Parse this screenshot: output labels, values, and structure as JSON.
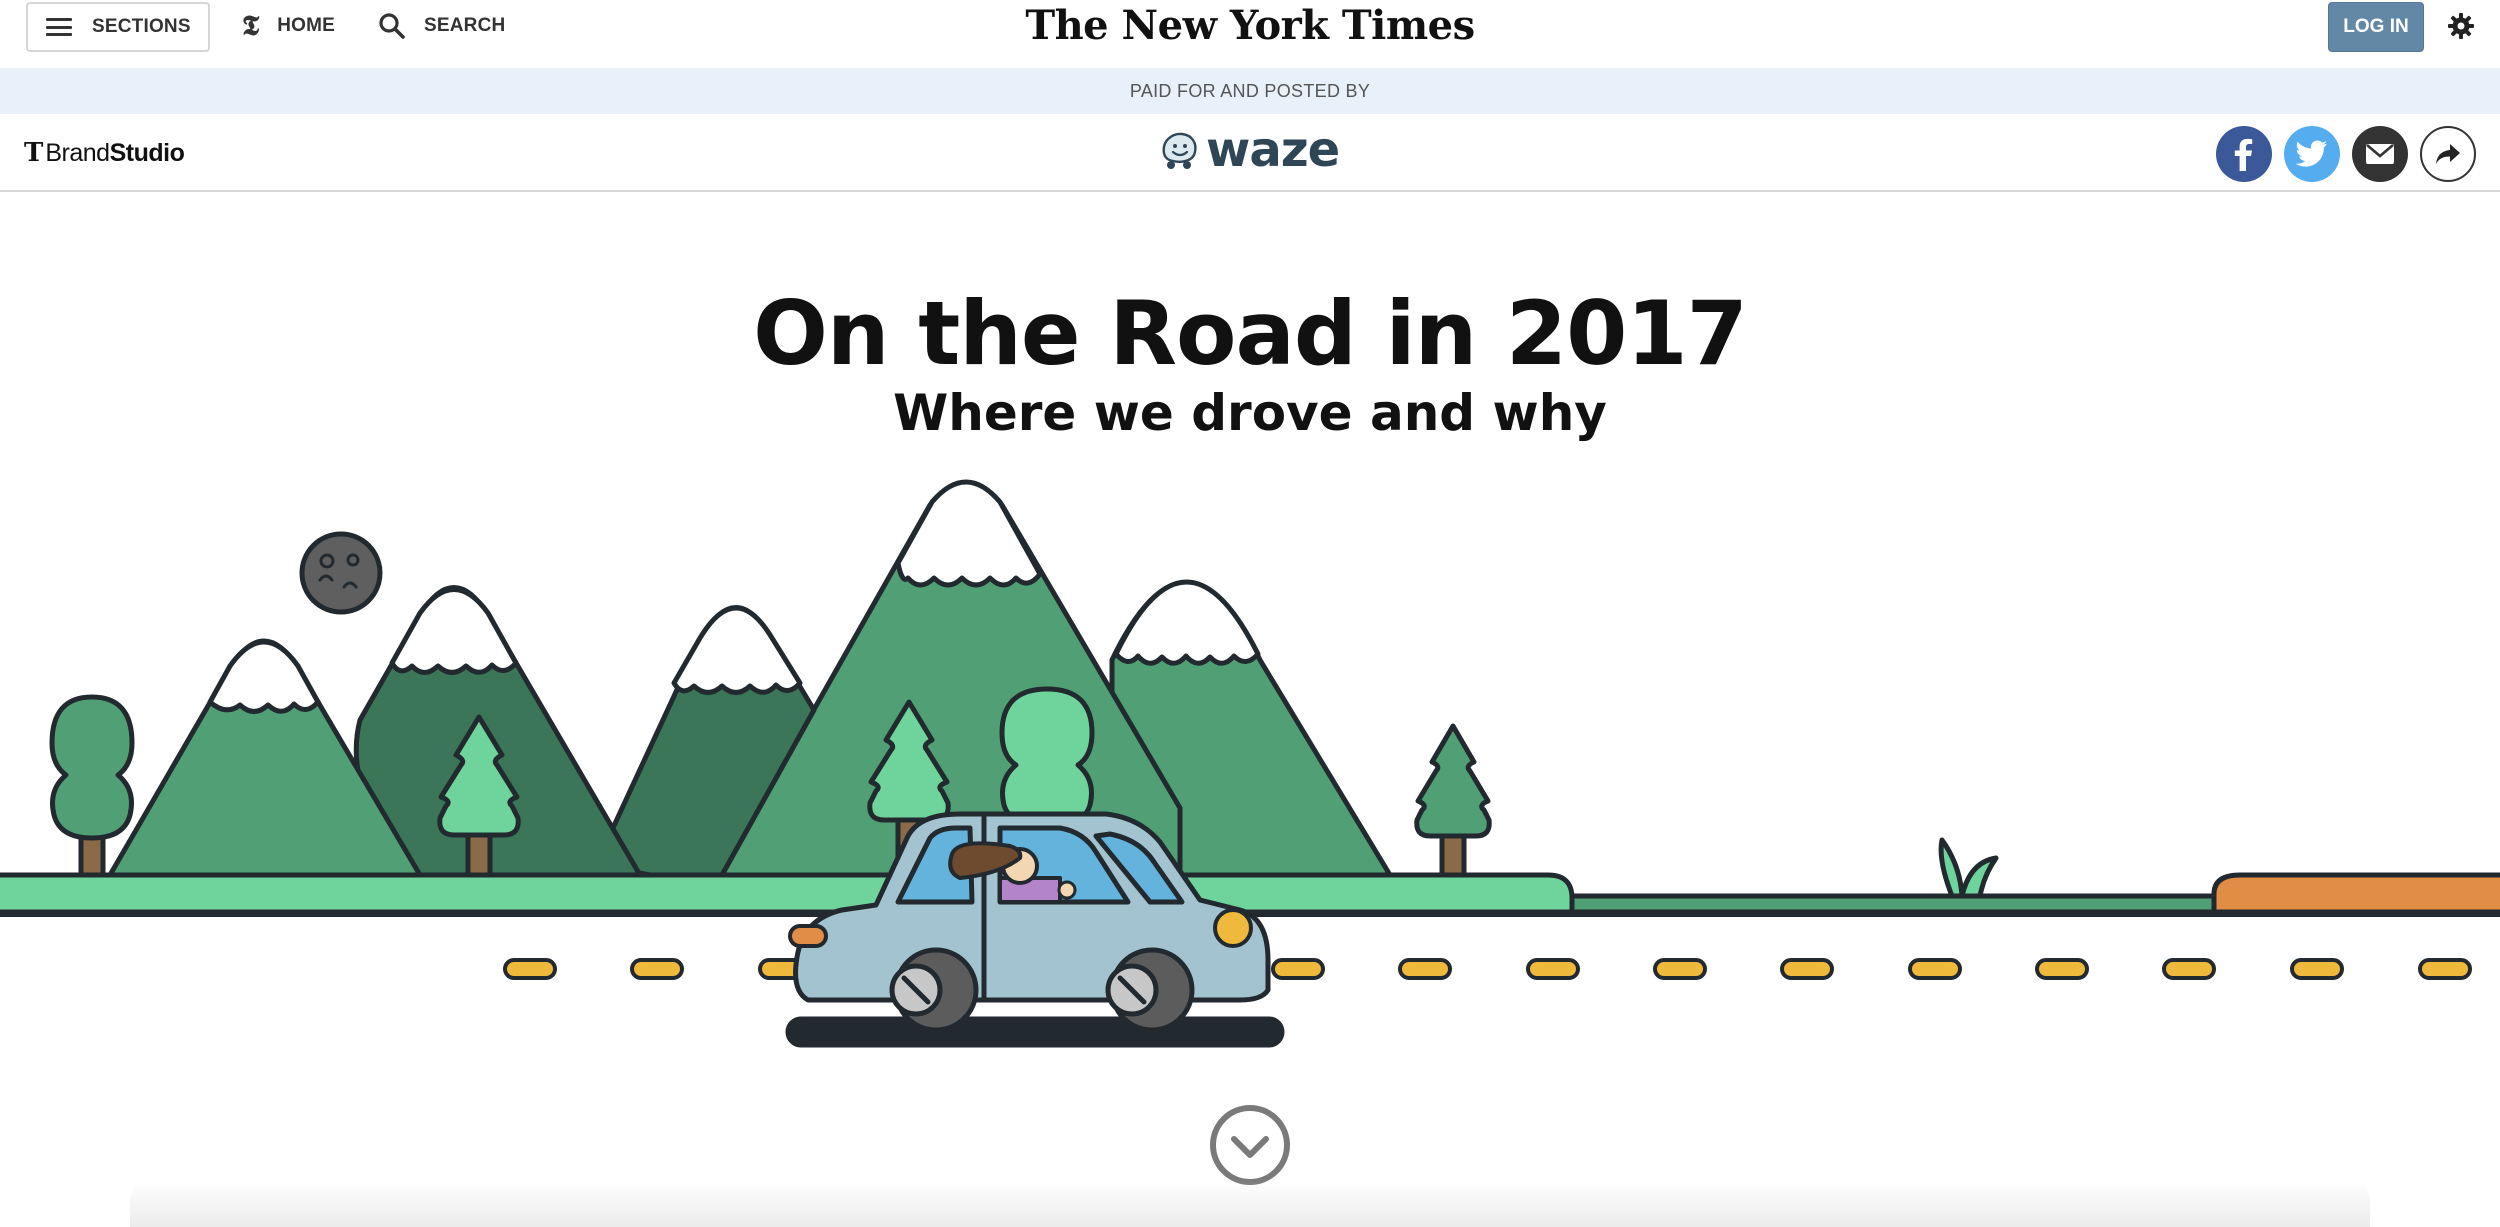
{
  "nav": {
    "sections_label": "SECTIONS",
    "home_label": "HOME",
    "search_label": "SEARCH",
    "masthead": "The New York Times",
    "login_label": "LOG IN"
  },
  "sponsor_band": {
    "text": "PAID FOR AND POSTED BY"
  },
  "brand_bar": {
    "brand_t": "T",
    "brand_part1": "Brand",
    "brand_part2": "Studio",
    "sponsor_name": "waze",
    "share": [
      {
        "name": "facebook",
        "icon": "facebook-icon",
        "color": "#3b5998"
      },
      {
        "name": "twitter",
        "icon": "twitter-icon",
        "color": "#55acee"
      },
      {
        "name": "email",
        "icon": "email-icon",
        "color": "#333333"
      },
      {
        "name": "more",
        "icon": "share-arrow-icon",
        "color": "#ffffff"
      }
    ]
  },
  "hero": {
    "title": "On the Road in 2017",
    "subtitle": "Where we drove and why"
  },
  "illustration": {
    "subject": "car-driving-past-mountains",
    "colors": {
      "mountain_light": "#519f75",
      "mountain_dark": "#3b7658",
      "tree_light": "#6fd49c",
      "grass": "#6fd49c",
      "car_body": "#a3c3d1",
      "road_dash": "#efb93b",
      "moon": "#5f5f5f",
      "orange_ground": "#e28d45",
      "outline": "#222a30"
    }
  },
  "icons": {
    "menu": "hamburger-icon",
    "home": "nyt-t-icon",
    "search": "search-icon",
    "settings": "gear-icon",
    "scroll": "chevron-down-circle-icon"
  }
}
